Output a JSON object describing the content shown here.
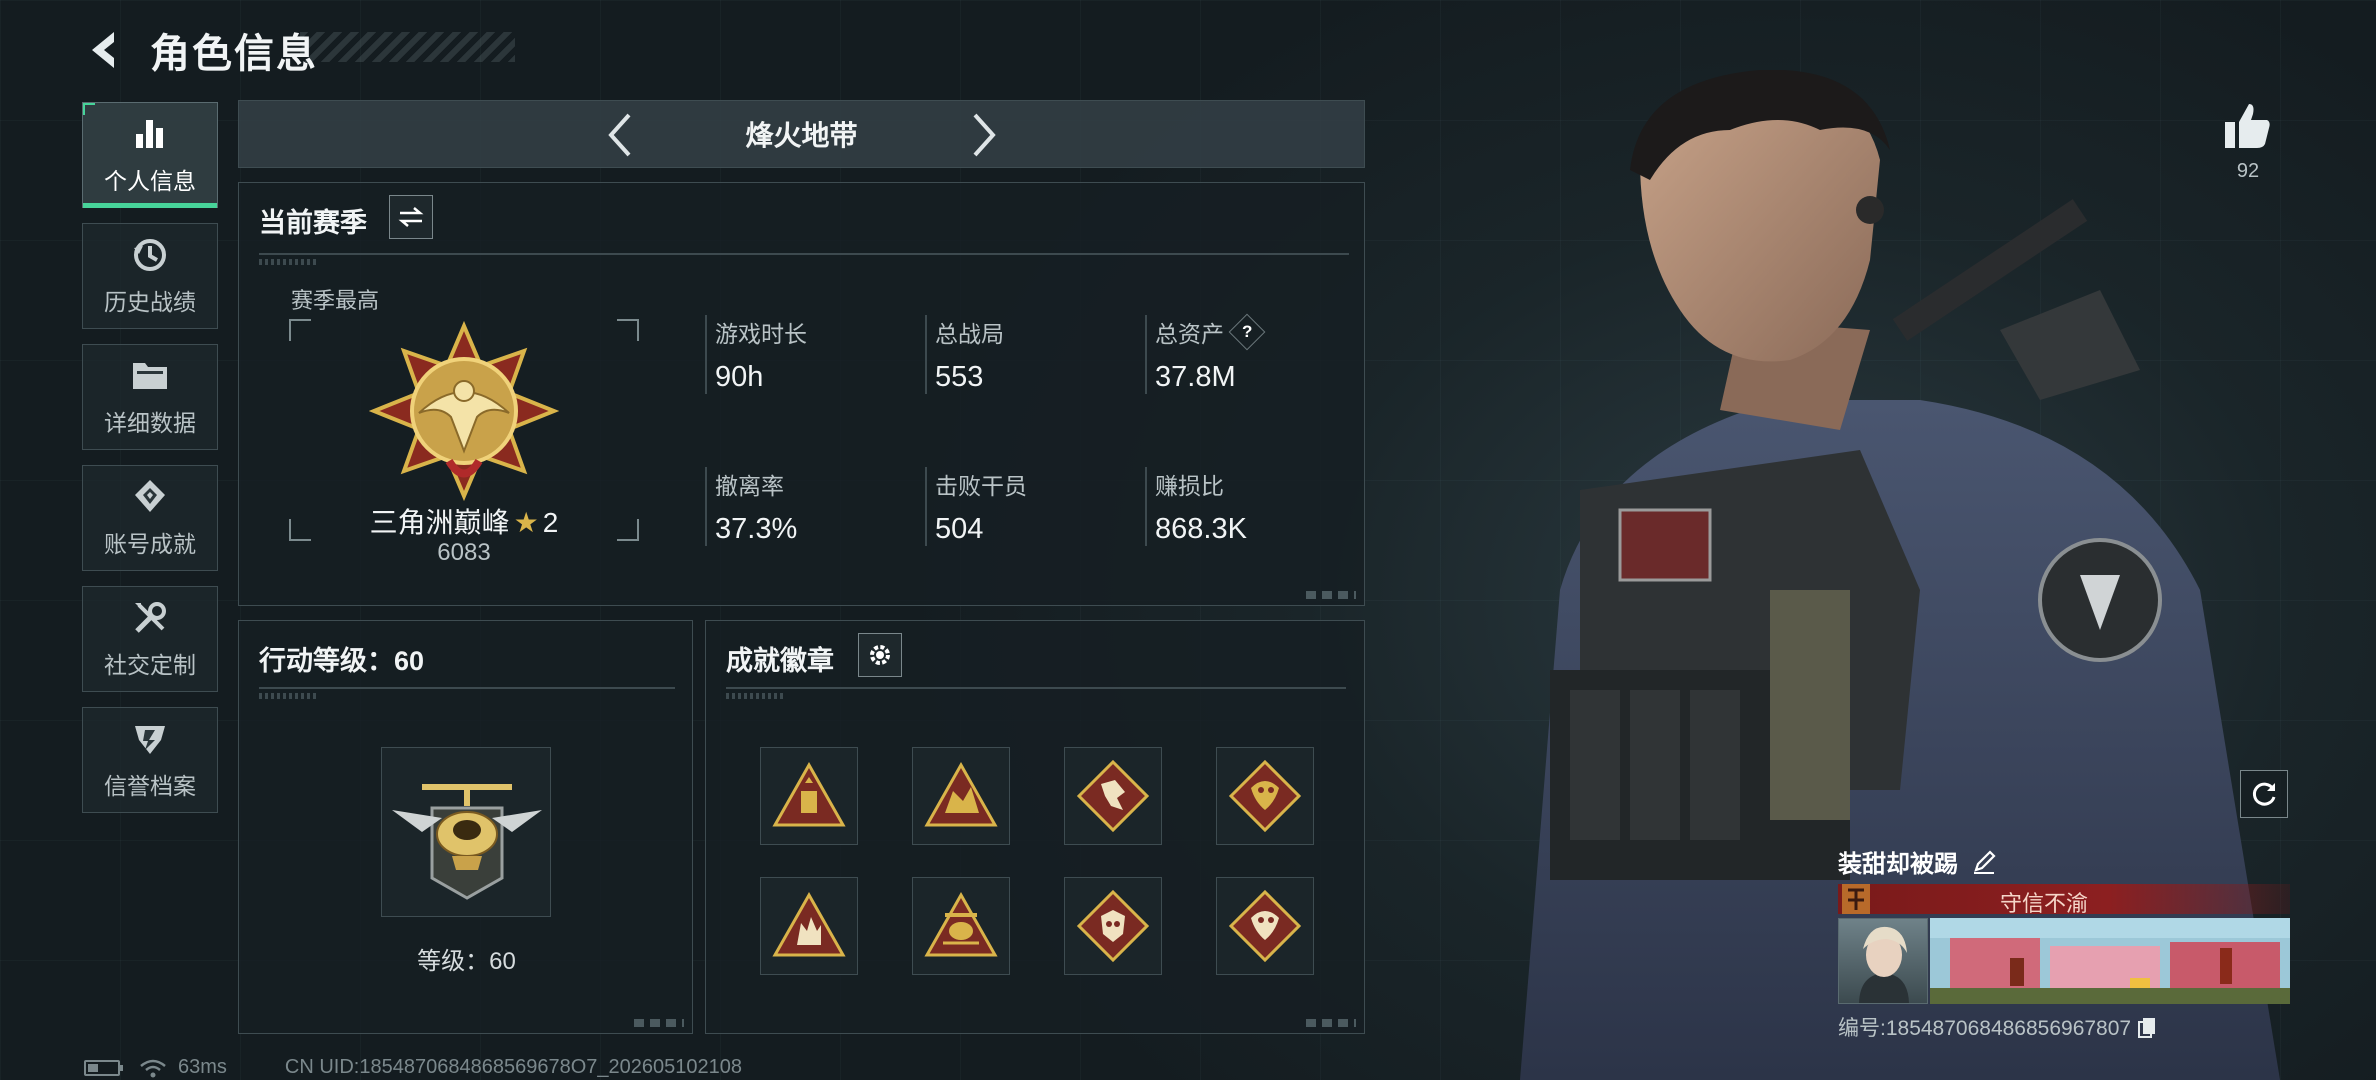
{
  "header": {
    "title": "角色信息"
  },
  "sidebar": {
    "items": [
      {
        "label": "个人信息",
        "icon": "bar-chart-icon",
        "active": true
      },
      {
        "label": "历史战绩",
        "icon": "history-clock-icon"
      },
      {
        "label": "详细数据",
        "icon": "folder-icon"
      },
      {
        "label": "账号成就",
        "icon": "achievement-icon"
      },
      {
        "label": "社交定制",
        "icon": "tools-icon"
      },
      {
        "label": "信誉档案",
        "icon": "reputation-icon"
      }
    ]
  },
  "mode": {
    "name": "烽火地带"
  },
  "season": {
    "title": "当前赛季",
    "best_label": "赛季最高",
    "rank_name": "三角洲巅峰",
    "rank_stars": "2",
    "rank_score": "6083",
    "stats": [
      {
        "label": "游戏时长",
        "value": "90h"
      },
      {
        "label": "总战局",
        "value": "553"
      },
      {
        "label": "总资产",
        "value": "37.8M",
        "help": "?"
      },
      {
        "label": "撤离率",
        "value": "37.3%"
      },
      {
        "label": "击败干员",
        "value": "504"
      },
      {
        "label": "赚损比",
        "value": "868.3K"
      }
    ]
  },
  "level": {
    "title": "行动等级：60",
    "text": "等级：60"
  },
  "achievements": {
    "title": "成就徽章"
  },
  "player": {
    "likes": "92",
    "name": "装甜却被踢",
    "title_badge": "守信不渝",
    "id_line": "编号:185487068486856967807"
  },
  "status": {
    "ping": "63ms",
    "uid": "CN UID:1854870684868569678O7_202605102108"
  },
  "colors": {
    "accent": "#47d49a",
    "gold": "#d9b44a",
    "badge_red": "#8c1f20"
  }
}
